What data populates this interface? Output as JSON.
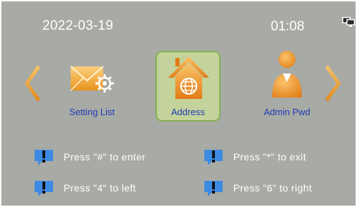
{
  "status_bar": {
    "date": "2022-03-19",
    "time": "01:08",
    "network_icon": "network-computer-icon"
  },
  "menu": {
    "items": [
      {
        "label": "Setting List",
        "icon": "envelope-gear-icon",
        "selected": false
      },
      {
        "label": "Address",
        "icon": "house-globe-icon",
        "selected": true
      },
      {
        "label": "Admin Pwd",
        "icon": "user-icon",
        "selected": false
      }
    ],
    "prev_icon": "chevron-left-icon",
    "next_icon": "chevron-right-icon"
  },
  "hints": [
    {
      "text": "Press \"#\" to enter",
      "icon": "info-icon"
    },
    {
      "text": "Press \"*\" to exit",
      "icon": "info-icon"
    },
    {
      "text": "Press \"4\" to left",
      "icon": "info-icon"
    },
    {
      "text": "Press \"6\" to right",
      "icon": "info-icon"
    }
  ],
  "colors": {
    "background": "#a8aaa5",
    "label": "#1e3cb4",
    "selected_fill": "#c4d39b",
    "selected_border": "#86ae54",
    "accent_orange": "#f2a23a"
  }
}
